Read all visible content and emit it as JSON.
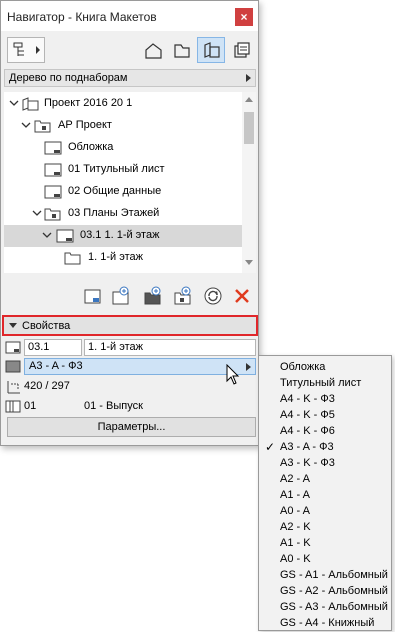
{
  "window": {
    "title": "Навигатор - Книга Макетов",
    "close_glyph": "×"
  },
  "toolbar": {
    "buttons": [
      "navigator-settings-icon",
      "project-map-icon",
      "view-map-icon",
      "layout-book-icon",
      "publisher-sets-icon"
    ],
    "active": "layout-book-icon"
  },
  "view_selector": {
    "value": "Дерево по поднаборам"
  },
  "tree": {
    "items": [
      {
        "label": "Проект 2016 20 1",
        "icon": "book-icon"
      },
      {
        "label": "АР Проект",
        "icon": "subset-folder-icon"
      },
      {
        "label": "Обложка",
        "icon": "master-layout-icon"
      },
      {
        "label": "01 Титульный лист",
        "icon": "master-layout-icon"
      },
      {
        "label": "02 Общие данные",
        "icon": "master-layout-icon"
      },
      {
        "label": "03 Планы Этажей",
        "icon": "subset-folder-icon"
      },
      {
        "label": "03.1 1. 1-й этаж",
        "icon": "layout-icon",
        "selected": true
      },
      {
        "label": "1. 1-й этаж",
        "icon": "drawing-icon"
      }
    ]
  },
  "actions": [
    "new-master-layout-icon",
    "new-layout-icon",
    "new-subset-icon",
    "clone-icon",
    "update-icon",
    "delete-icon"
  ],
  "properties": {
    "header": "Свойства",
    "id_value": "03.1",
    "name_value": "1. 1-й этаж",
    "master_value": "A3 - A - Ф3",
    "size_value": "420 / 297",
    "revision_id": "01",
    "revision_label": "01 - Выпуск",
    "params_button": "Параметры..."
  },
  "master_menu": {
    "items": [
      "Обложка",
      "Титульный лист",
      "A4 - K - Ф3",
      "A4 - K - Ф5",
      "A4 - K - Ф6",
      "A3 - A - Ф3",
      "A3 - K - Ф3",
      "A2 - A",
      "A1 - A",
      "A0 - A",
      "A2 - K",
      "A1 - K",
      "A0 - K",
      "GS - A1 - Альбомный",
      "GS - A2 - Альбомный",
      "GS - A3 - Альбомный",
      "GS - A4 - Книжный"
    ],
    "checked_index": 5,
    "check_glyph": "✓"
  },
  "colors": {
    "accent_blue": "#cfe3f6",
    "highlight_red": "#e0262a",
    "delete_red": "#e03a1e"
  }
}
